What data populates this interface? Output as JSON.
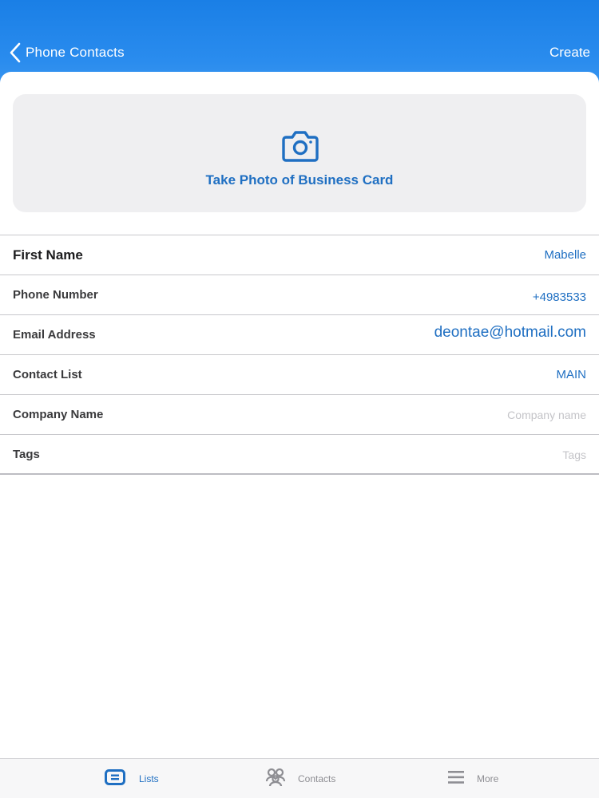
{
  "header": {
    "back_label": "Phone Contacts",
    "create_label": "Create"
  },
  "photo_card": {
    "label": "Take Photo of Business Card",
    "icon": "camera-icon"
  },
  "form": {
    "first_name": {
      "label": "First Name",
      "value": "Mabelle"
    },
    "phone_number": {
      "label": "Phone Number",
      "value": "+4983533"
    },
    "email_address": {
      "label": "Email Address",
      "value": "deontae@hotmail.com"
    },
    "contact_list": {
      "label": "Contact List",
      "value": "MAIN"
    },
    "company_name": {
      "label": "Company Name",
      "placeholder": "Company name"
    },
    "tags": {
      "label": "Tags",
      "placeholder": "Tags"
    }
  },
  "tabbar": {
    "lists": "Lists",
    "contacts": "Contacts",
    "more": "More"
  },
  "colors": {
    "header_blue": "#1a7fe6",
    "accent_blue": "#1f6fc2",
    "card_gray": "#efeff1",
    "placeholder_gray": "#c4c4c8",
    "tab_inactive": "#8e8e93"
  }
}
